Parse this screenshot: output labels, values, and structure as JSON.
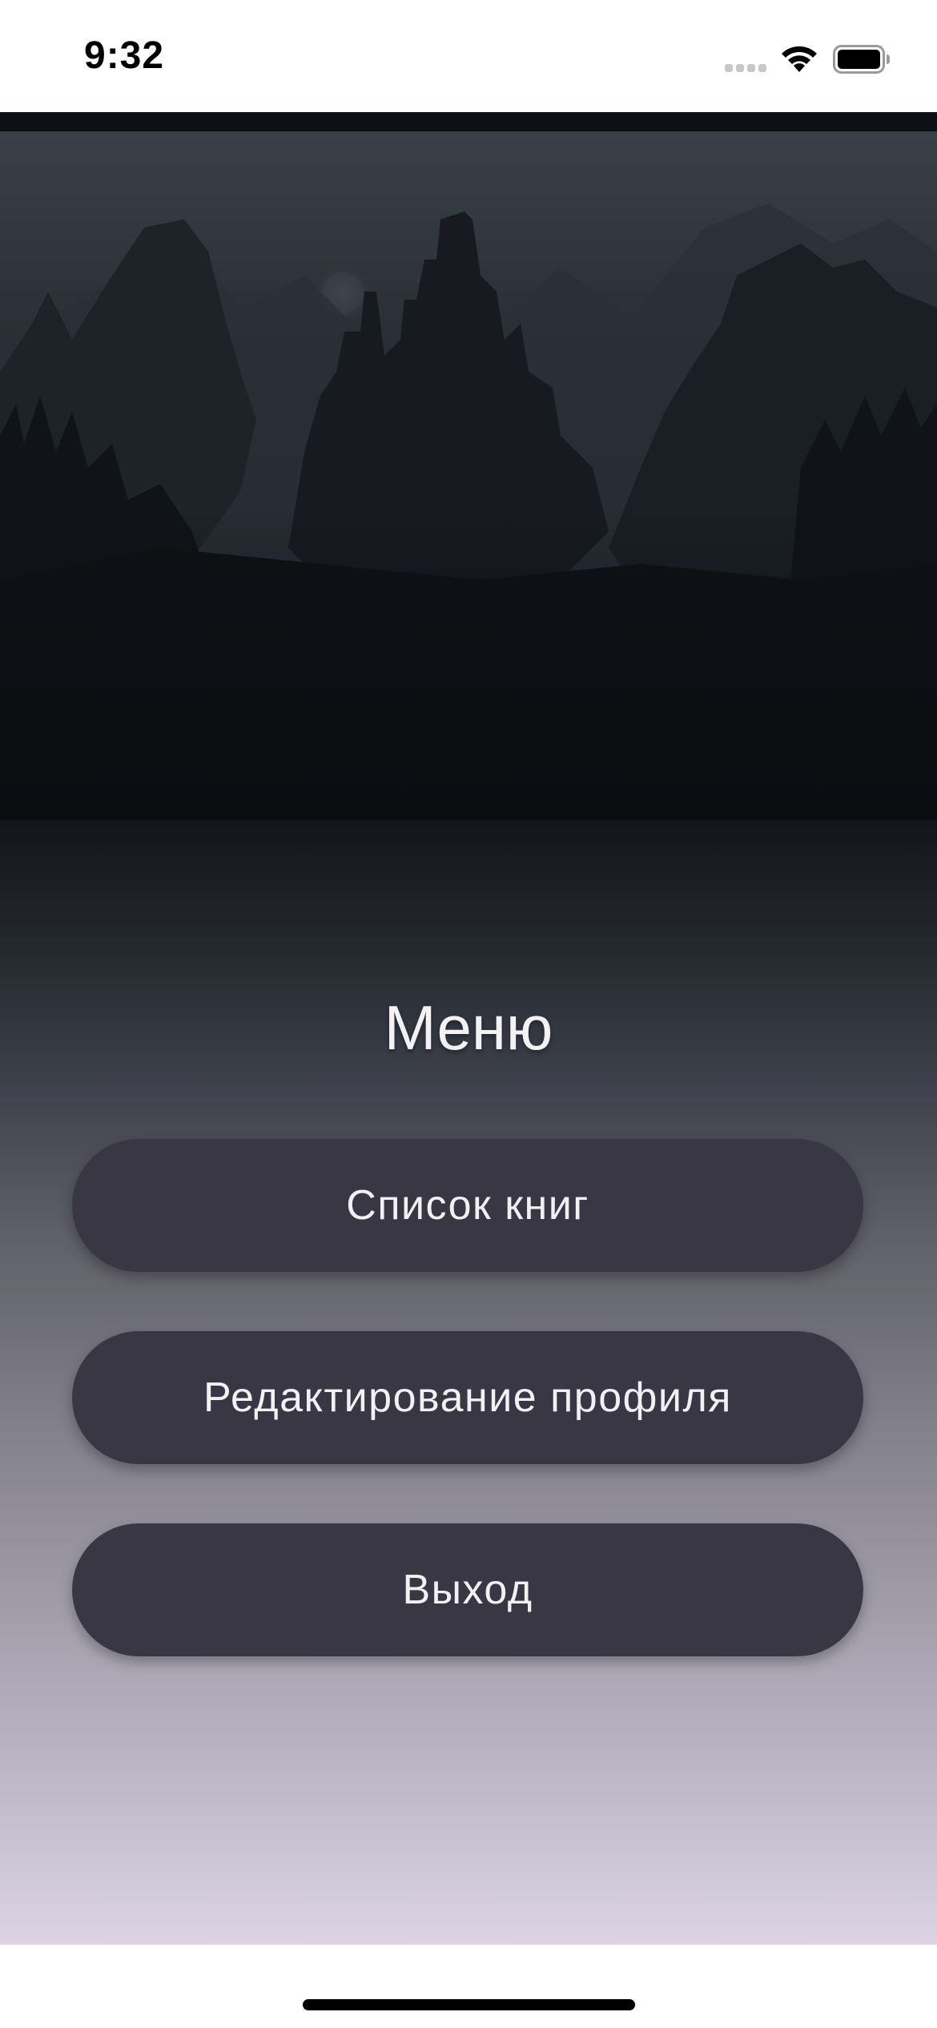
{
  "status_bar": {
    "time": "9:32"
  },
  "menu": {
    "title": "Меню",
    "buttons": [
      {
        "label": "Список книг"
      },
      {
        "label": "Редактирование профиля"
      },
      {
        "label": "Выход"
      }
    ]
  },
  "icons": {
    "signal": "cellular-signal-icon",
    "wifi": "wifi-icon",
    "battery": "battery-icon"
  },
  "colors": {
    "button_background": "#393744",
    "button_text": "#f1f1f4",
    "title_text": "#f2f2f4",
    "gradient_top": "#0b0d11",
    "gradient_bottom": "#dcd4e3"
  }
}
